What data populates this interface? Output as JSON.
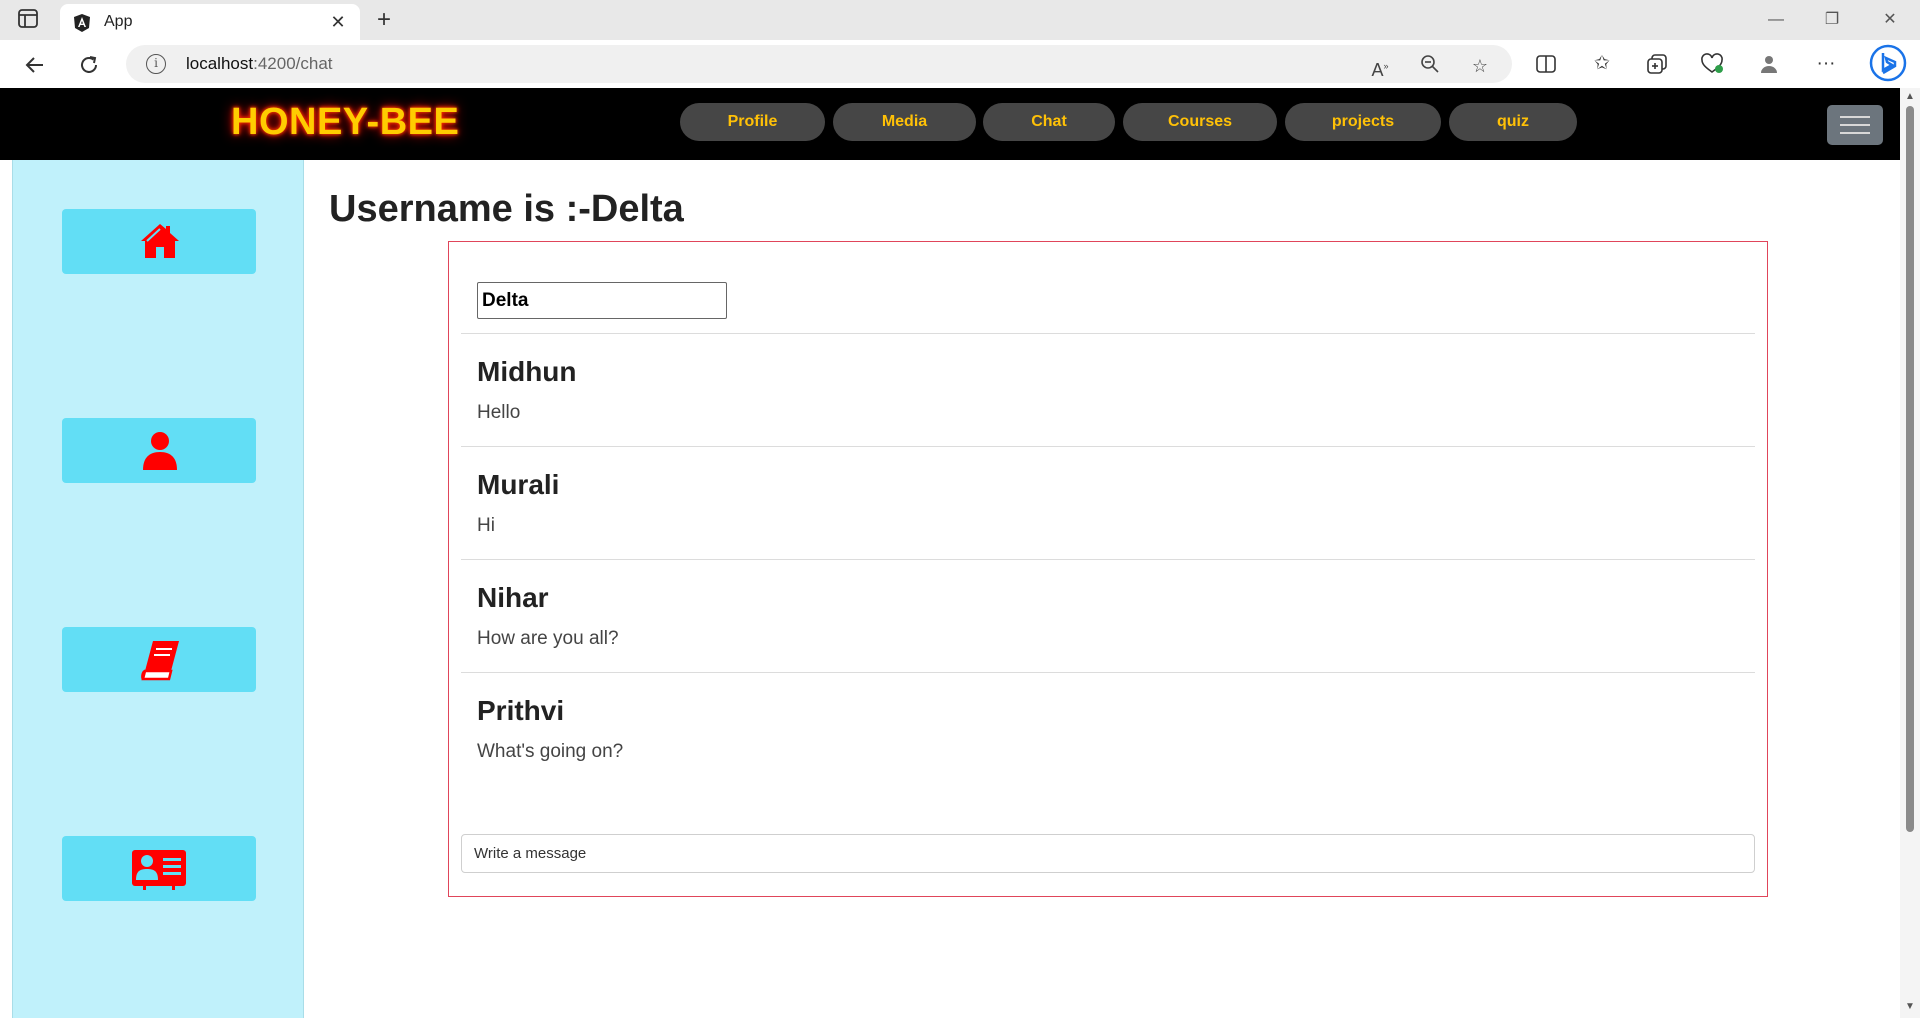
{
  "browser": {
    "tab_title": "App",
    "tab_favicon": "angular-icon",
    "url_host": "localhost",
    "url_path": ":4200/chat",
    "win_min": "—",
    "win_restore": "❐",
    "win_close": "✕"
  },
  "navbar": {
    "brand": "HONEY-BEE",
    "links": [
      "Profile",
      "Media",
      "Chat",
      "Courses",
      "projects",
      "quiz"
    ],
    "accent_color": "#ffc107"
  },
  "sidebar": {
    "items": [
      {
        "icon": "home-icon"
      },
      {
        "icon": "user-icon"
      },
      {
        "icon": "book-icon"
      },
      {
        "icon": "contact-card-icon"
      }
    ],
    "icon_color": "#ff0000"
  },
  "main": {
    "title": "Username is :-Delta",
    "username_value": "Delta",
    "messages": [
      {
        "sender": "Midhun",
        "text": "Hello"
      },
      {
        "sender": "Murali",
        "text": "Hi"
      },
      {
        "sender": "Nihar",
        "text": "How are you all?"
      },
      {
        "sender": "Prithvi",
        "text": "What's going on?"
      }
    ],
    "message_placeholder": "Write a message"
  }
}
